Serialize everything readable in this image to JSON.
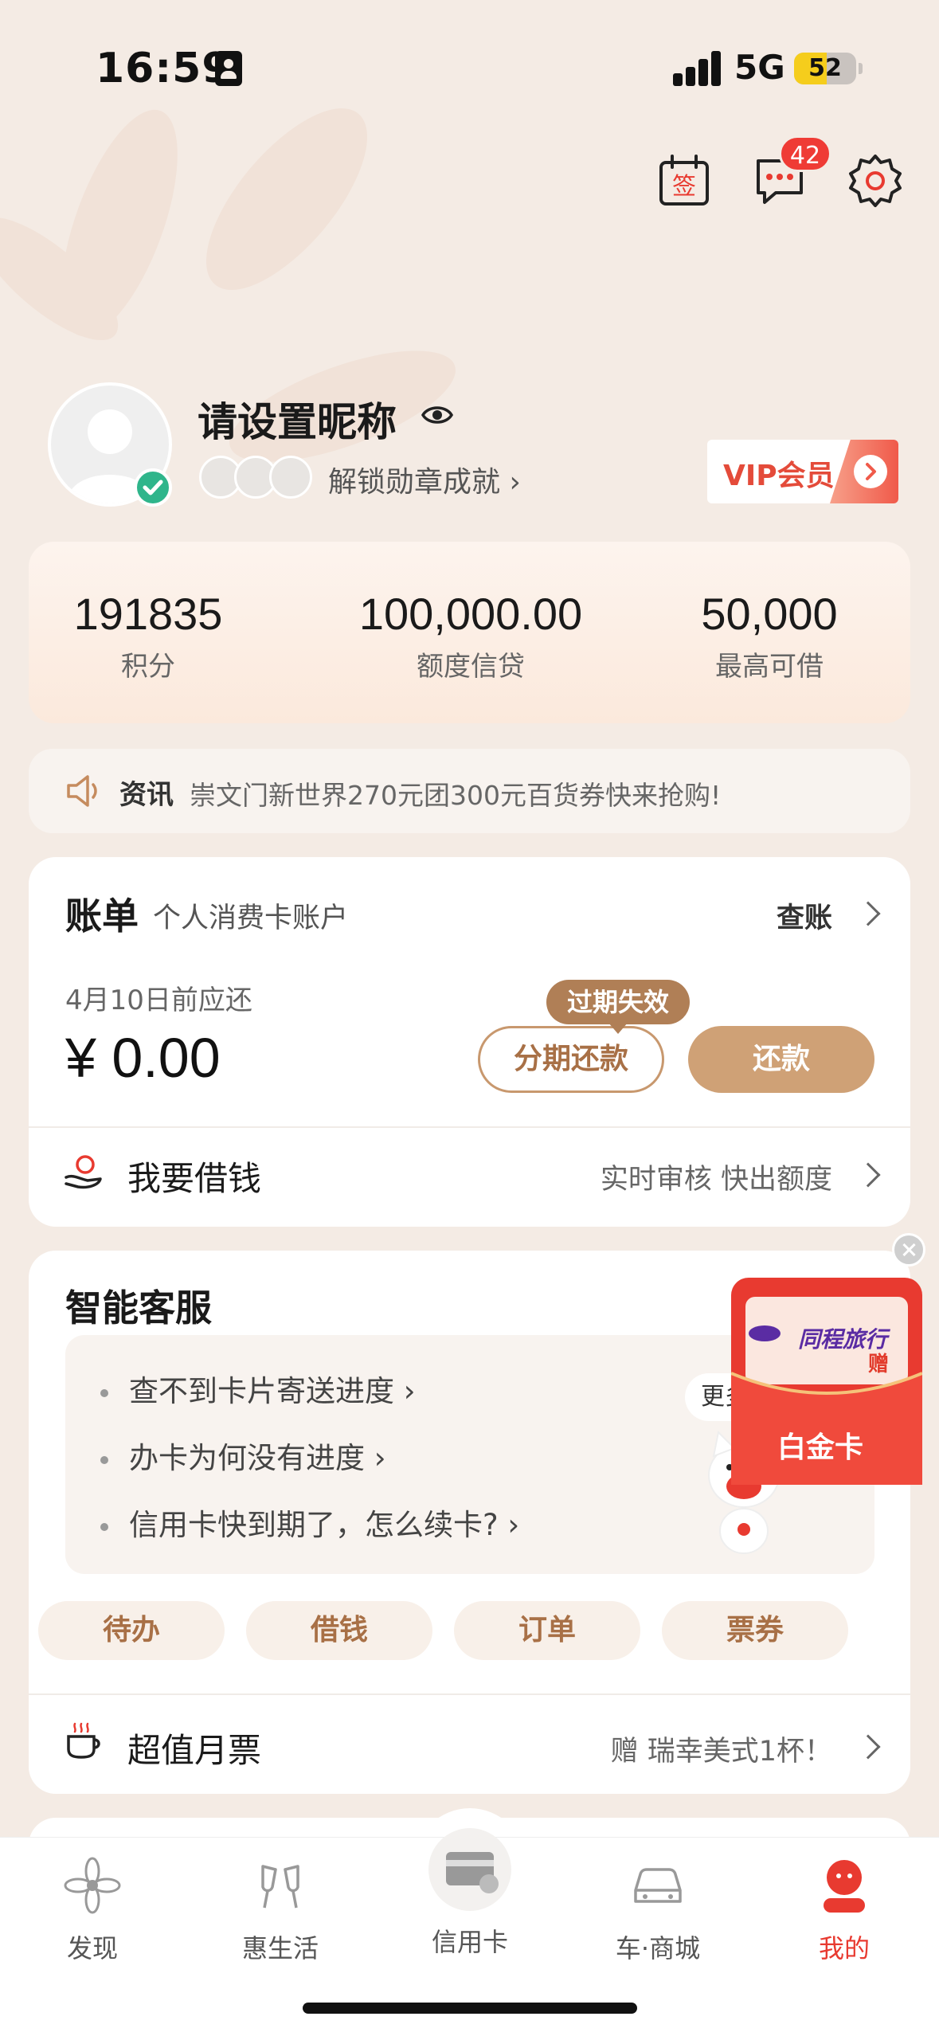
{
  "status_bar": {
    "time": "16:59",
    "network": "5G",
    "battery": "52",
    "battery_level": 0.52
  },
  "header": {
    "checkin_icon_char": "签",
    "messages_badge": "42"
  },
  "profile": {
    "nickname": "请设置昵称",
    "medals_link": "解锁勋章成就",
    "vip_label": "VIP会员"
  },
  "stats": [
    {
      "value": "191835",
      "label": "积分"
    },
    {
      "value": "100,000.00",
      "label": "额度信贷"
    },
    {
      "value": "50,000",
      "label": "最高可借"
    }
  ],
  "news": {
    "tag": "资讯",
    "text": "崇文门新世界270元团300元百货券快来抢购!"
  },
  "bill": {
    "title": "账单",
    "subtitle": "个人消费卡账户",
    "check_label": "查账",
    "due_text": "4月10日前应还",
    "amount": "¥ 0.00",
    "installment_label": "分期还款",
    "expired_tag": "过期失效",
    "repay_label": "还款",
    "borrow_label": "我要借钱",
    "borrow_desc": "实时审核 快出额度"
  },
  "service": {
    "title": "智能客服",
    "faq": [
      "查不到卡片寄送进度",
      "办卡为何没有进度",
      "信用卡快到期了，怎么续卡?"
    ],
    "more_questions": "更多问",
    "pills": [
      "待办",
      "借钱",
      "订单",
      "票券"
    ],
    "ticket_label": "超值月票",
    "ticket_desc": "赠 瑞幸美式1杯！"
  },
  "promo": {
    "brand": "同程旅行",
    "gift": "赠",
    "label": "白金卡"
  },
  "tabbar": [
    {
      "label": "发现",
      "icon": "discover-icon",
      "active": false
    },
    {
      "label": "惠生活",
      "icon": "cheers-icon",
      "active": false
    },
    {
      "label": "信用卡",
      "icon": "credit-card-icon",
      "active": false
    },
    {
      "label": "车·商城",
      "icon": "car-icon",
      "active": false
    },
    {
      "label": "我的",
      "icon": "profile-icon",
      "active": true
    }
  ],
  "colors": {
    "accent": "#cfa176",
    "accent_text": "#a87046",
    "red": "#e83a30",
    "background": "#f4ebe4"
  }
}
